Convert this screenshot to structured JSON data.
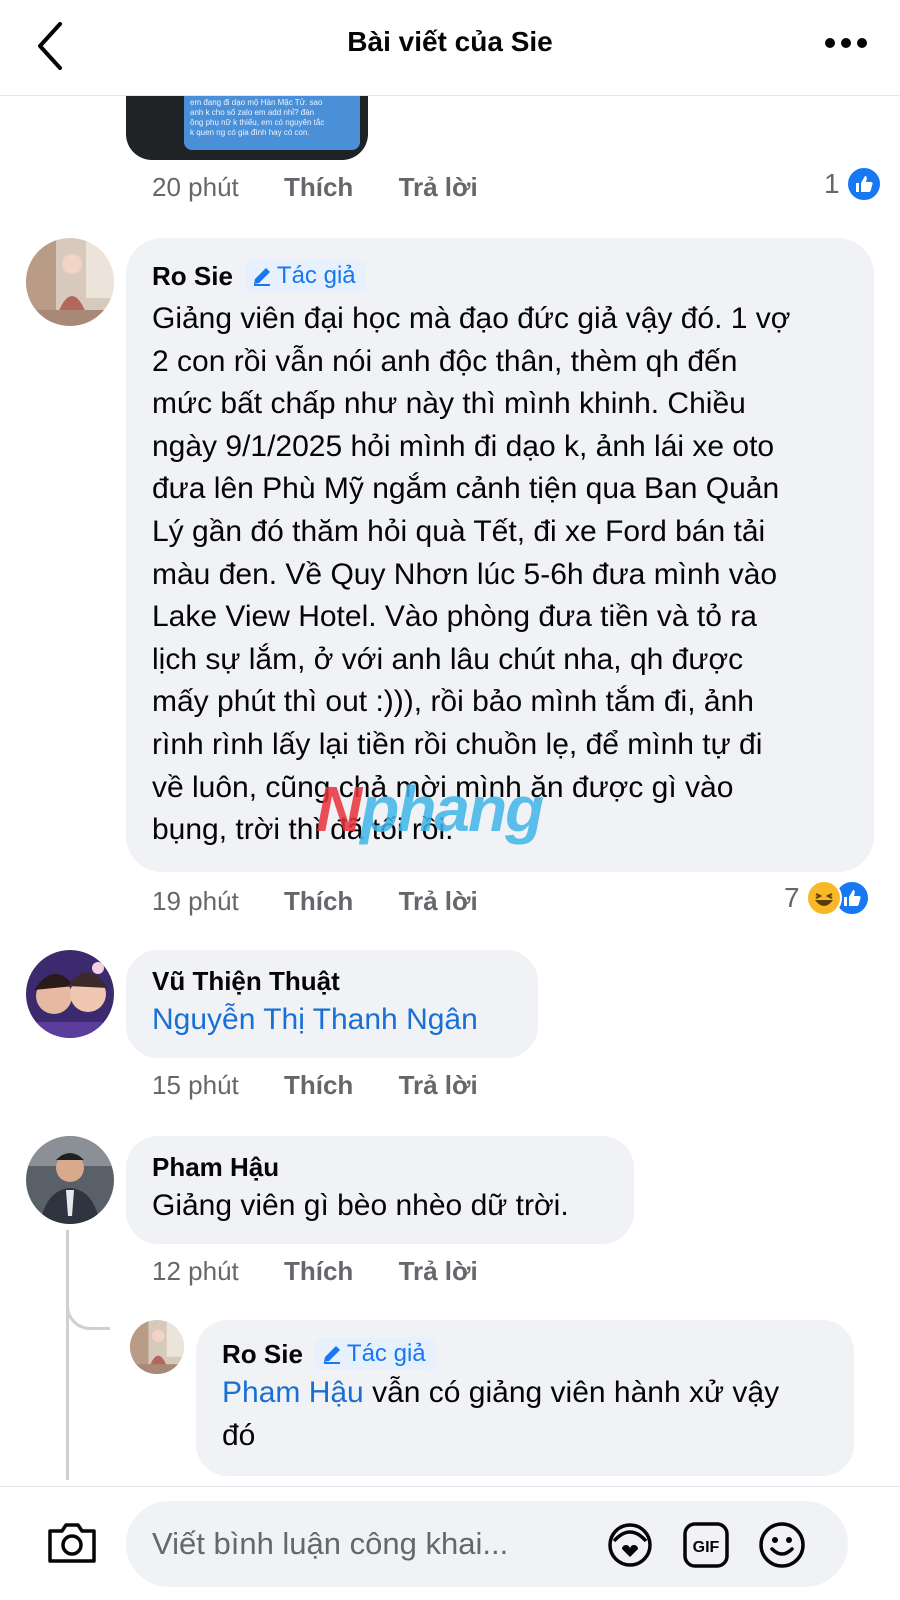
{
  "header": {
    "title": "Bài viết của Sie"
  },
  "top_image": {
    "text_lines": [
      "em đang đi dạo mộ Hàn Mặc Tử. sao",
      "anh k cho số zalo em add nhỉ? đàn",
      "ông phụ nữ k thiếu, em có nguyên tắc",
      "k quen ng có gia đình hay có con."
    ]
  },
  "top_meta": {
    "time": "20 phút",
    "like": "Thích",
    "reply": "Trả lời",
    "reaction_count": "1"
  },
  "comments": [
    {
      "author": "Ro Sie",
      "badge": "Tác giả",
      "lines": [
        "Giảng viên đại học mà đạo đức giả vậy đó. 1 vợ",
        "2 con rồi vẫn nói anh độc thân, thèm qh đến",
        "mức bất chấp như này thì mình khinh. Chiều",
        "ngày 9/1/2025 hỏi mình đi dạo k, ảnh lái xe oto",
        "đưa lên Phù Mỹ ngắm cảnh tiện qua Ban Quản",
        "Lý gần đó thăm hỏi quà Tết, đi xe Ford bán tải",
        "màu đen. Về Quy Nhơn lúc 5-6h đưa mình vào",
        "Lake View Hotel. Vào phòng đưa tiền và tỏ ra",
        "lịch sự lắm, ở với anh lâu chút nha, qh được",
        "mấy phút thì out :))), rồi bảo mình tắm đi, ảnh",
        "rình rình lấy lại tiền rồi chuồn lẹ, để mình tự đi",
        "về luôn, cũng chả mời mình ăn được gì vào",
        "bụng, trời thì đã tối rồi."
      ],
      "time": "19 phút",
      "like": "Thích",
      "reply": "Trả lời",
      "reaction_count": "7"
    },
    {
      "author": "Vũ Thiện Thuật",
      "mention": "Nguyễn Thị Thanh Ngân",
      "time": "15 phút",
      "like": "Thích",
      "reply": "Trả lời"
    },
    {
      "author": "Pham Hậu",
      "text": "Giảng viên gì bèo nhèo dữ trời.",
      "time": "12 phút",
      "like": "Thích",
      "reply": "Trả lời"
    }
  ],
  "reply": {
    "author": "Ro Sie",
    "badge": "Tác giả",
    "mention": "Pham Hậu",
    "text_line1": " vẫn có giảng viên hành xử vậy",
    "text_line2": "đó"
  },
  "watermark": {
    "part1": "N",
    "part2": "phang"
  },
  "composer": {
    "placeholder": "Viết bình luận công khai..."
  },
  "icons": {
    "back": "chevron-left-icon",
    "more": "more-horizontal-icon",
    "like": "like-icon",
    "haha": "haha-icon",
    "edit": "pencil-icon",
    "camera": "camera-icon",
    "avatar_sticker": "avatar-sticker-icon",
    "gif": "gif-icon",
    "emoji": "emoji-icon"
  },
  "colors": {
    "link": "#1870d5",
    "like_blue": "#1877f2",
    "bubble": "#f0f2f5",
    "muted": "#65676b"
  }
}
